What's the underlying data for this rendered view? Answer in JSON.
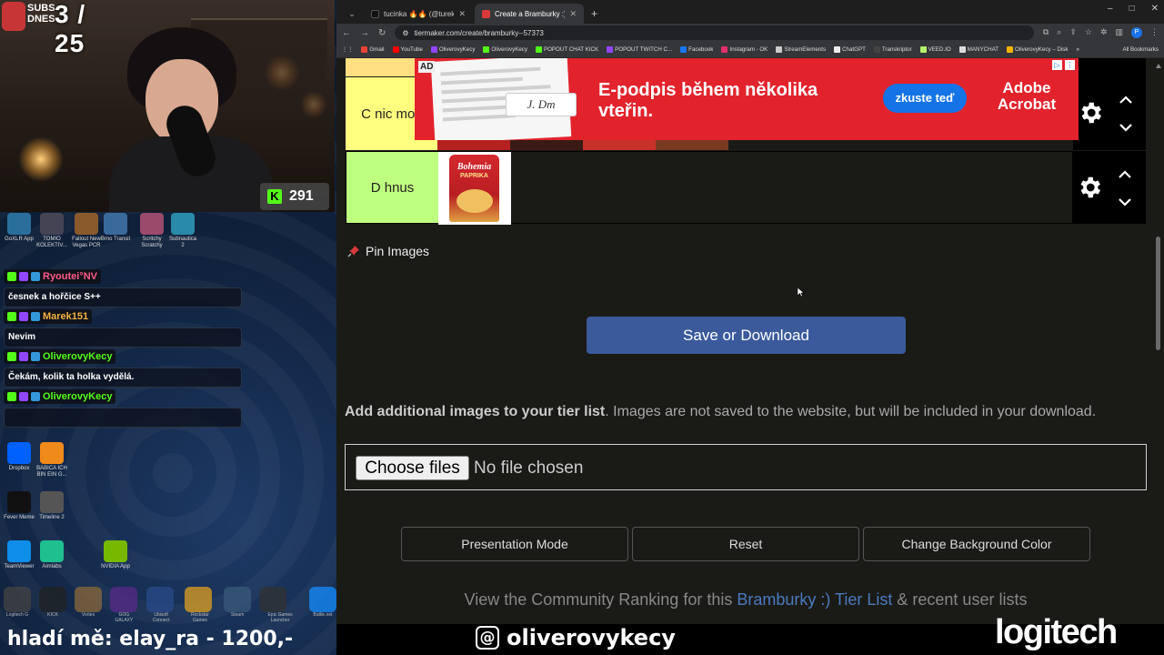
{
  "stream": {
    "subs_label": "SUBS\nDNES",
    "subs_count": "3 / 25",
    "kick_count": "291",
    "desktop_icons": [
      {
        "label": "GoXLR App",
        "color": "#2a6f9c"
      },
      {
        "label": "TOMIO KOLEKTIV...",
        "color": "#445"
      },
      {
        "label": "Fallout New Vegas PCR",
        "color": "#8a5a2b"
      },
      {
        "label": "Brno Transit",
        "color": "#3a6a9a"
      },
      {
        "label": "Scritchy Scratchy",
        "color": "#9a4a6a"
      },
      {
        "label": "Subnautica 2",
        "color": "#2a8aaa"
      },
      {
        "label": "Dropbox",
        "color": "#0061fe"
      },
      {
        "label": "BABICA ICH BIN EIN G...",
        "color": "#f08a1a"
      },
      {
        "label": "Fever Meme",
        "color": "#111"
      },
      {
        "label": "Timeline 2",
        "color": "#555"
      },
      {
        "label": "TeamViewer",
        "color": "#0e8ee9"
      },
      {
        "label": "Aimlabs",
        "color": "#1fbf8f"
      },
      {
        "label": "NVIDIA App",
        "color": "#76b900"
      }
    ],
    "chat": [
      {
        "user": "Ryoutei°NV",
        "user_color": "#ff5a8a",
        "text": "česnek a hořčice S++"
      },
      {
        "user": "Marek151",
        "user_color": "#f5b041",
        "text": "Nevim"
      },
      {
        "user": "OliverovyKecy",
        "user_color": "#53fc18",
        "text": "Čekám, kolik ta holka vydělá."
      },
      {
        "user": "OliverovyKecy",
        "user_color": "#53fc18",
        "text": ""
      }
    ],
    "taskbar": [
      "Logitech G",
      "KICK",
      "Vortex",
      "GOG GALAXY",
      "Ubisoft Connect",
      "Rockstar Games",
      "Steam",
      "Epic Games Launcher",
      "Battle.net"
    ],
    "ticker": "hladí mě: elay_ra - 1200,-",
    "threads_handle": "oliverovykecy",
    "threads_glyph": "@",
    "sponsor": "logitech"
  },
  "browser": {
    "tabs": [
      {
        "title": "tucinka 🔥🔥 (@turek.x.macin",
        "active": false
      },
      {
        "title": "Create a Bramburky :) Tier List",
        "active": true
      }
    ],
    "new_tab": "+",
    "window_controls": [
      "–",
      "□",
      "✕"
    ],
    "url": "tiermaker.com/create/bramburky--57373",
    "profile_letter": "P",
    "bookmarks": [
      {
        "label": "Gmail",
        "color": "#ea4335"
      },
      {
        "label": "YouTube",
        "color": "#ff0000"
      },
      {
        "label": "OliverovyKecy",
        "color": "#9146ff"
      },
      {
        "label": "OliverovyKecy",
        "color": "#53fc18"
      },
      {
        "label": "POPOUT CHAT KICK",
        "color": "#53fc18"
      },
      {
        "label": "POPOUT TWITCH C...",
        "color": "#9146ff"
      },
      {
        "label": "Facebook",
        "color": "#1877f2"
      },
      {
        "label": "Instagram - OK",
        "color": "#e1306c"
      },
      {
        "label": "StreamElements",
        "color": "#ccc"
      },
      {
        "label": "ChatGPT",
        "color": "#eee"
      },
      {
        "label": "Transkriptor",
        "color": "#444"
      },
      {
        "label": "VEED.IO",
        "color": "#b6f36a"
      },
      {
        "label": "MANYCHAT",
        "color": "#ddd"
      },
      {
        "label": "OliverovyKecy – Disk",
        "color": "#f4b400"
      }
    ],
    "bookmarks_all": "All Bookmarks"
  },
  "tierlist": {
    "tiers": [
      {
        "label": "C nic moc",
        "color": "#ffff7f"
      },
      {
        "label": "D hnus",
        "color": "#bfff7f"
      }
    ],
    "chip_brand": "Bohemia",
    "chip_flavor": "PAPRIKA",
    "pin_label": "Pin Images",
    "save_button": "Save or Download",
    "additional_bold": "Add additional images to your tier list",
    "additional_rest": ". Images are not saved to the website, but will be included in your download.",
    "choose_files": "Choose files",
    "no_file": "No file chosen",
    "buttons": [
      "Presentation Mode",
      "Reset",
      "Change Background Color"
    ],
    "community_prefix": "View the Community Ranking for this ",
    "community_link": "Bramburky :) Tier List",
    "community_suffix": " & recent user lists"
  },
  "ad": {
    "badge": "AD",
    "headline": "E-podpis během několika vteřin.",
    "cta": "zkuste teď",
    "brand": "Adobe Acrobat",
    "signature": "J. Dm"
  }
}
